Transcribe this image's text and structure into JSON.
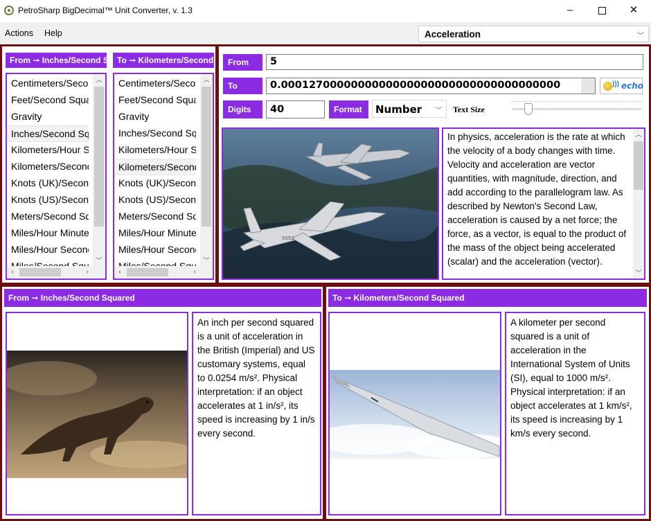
{
  "window": {
    "title": "PetroSharp BigDecimal™ Unit Converter, v. 1.3",
    "min_glyph": "–",
    "close_glyph": "✕"
  },
  "menu": {
    "actions": "Actions",
    "help": "Help"
  },
  "category": {
    "selected": "Acceleration"
  },
  "from_list": {
    "header": "From ➞ Inches/Second Squared",
    "items": [
      "Centimeters/Second Squared",
      "Feet/Second Squared",
      "Gravity",
      "Inches/Second Squared",
      "Kilometers/Hour Second",
      "Kilometers/Second Squared",
      "Knots (UK)/Second",
      "Knots (US)/Second",
      "Meters/Second Squared",
      "Miles/Hour Minute",
      "Miles/Hour Second",
      "Miles/Second Squared"
    ],
    "selected_index": 3
  },
  "to_list": {
    "header": "To ➞ Kilometers/Second Squared",
    "items": [
      "Centimeters/Second Squared",
      "Feet/Second Squared",
      "Gravity",
      "Inches/Second Squared",
      "Kilometers/Hour Second",
      "Kilometers/Second Squared",
      "Knots (UK)/Second",
      "Knots (US)/Second",
      "Meters/Second Squared",
      "Miles/Hour Minute",
      "Miles/Hour Second",
      "Miles/Second Squared"
    ],
    "selected_index": 5
  },
  "converter": {
    "from_label": "From",
    "from_value": "5",
    "to_label": "To",
    "to_value": "0.0001270000000000000000000000000000000000",
    "echo_label": "echo",
    "digits_label": "Digits",
    "digits_value": "40",
    "format_label": "Format",
    "format_value": "Number",
    "text_size_label": "Text Size",
    "text_size_level": 0.1
  },
  "category_description": "In physics, acceleration is the rate at which the velocity of a body changes with time. Velocity and acceleration are vector quantities, with magnitude, direction, and add according to the parallelogram law. As described by Newton's Second Law, acceleration is caused by a net force; the force, as a vector, is equal to the product of the mass of the object being accelerated (scalar) and the acceleration (vector).",
  "from_unit": {
    "header": "From ➞ Inches/Second Squared",
    "description": "An inch per second squared is a unit of acceleration in the British (Imperial) and US customary systems, equal to 0.0254 m/s². Physical interpretation: if an object accelerates at 1 in/s², its speed is increasing by 1 in/s every second."
  },
  "to_unit": {
    "header": "To ➞ Kilometers/Second Squared",
    "description": "A kilometer per second squared is a unit of acceleration in the International System of Units (SI), equal to 1000 m/s². Physical interpretation: if an object accelerates at 1 km/s², its speed is increasing by 1 km/s every second."
  },
  "colors": {
    "accent_purple": "#8b2be2",
    "frame_maroon": "#6b1010"
  },
  "icons": [
    "app-gear-icon",
    "minimize-icon",
    "maximize-icon",
    "close-icon",
    "chevron-down-icon",
    "speaker-icon"
  ]
}
